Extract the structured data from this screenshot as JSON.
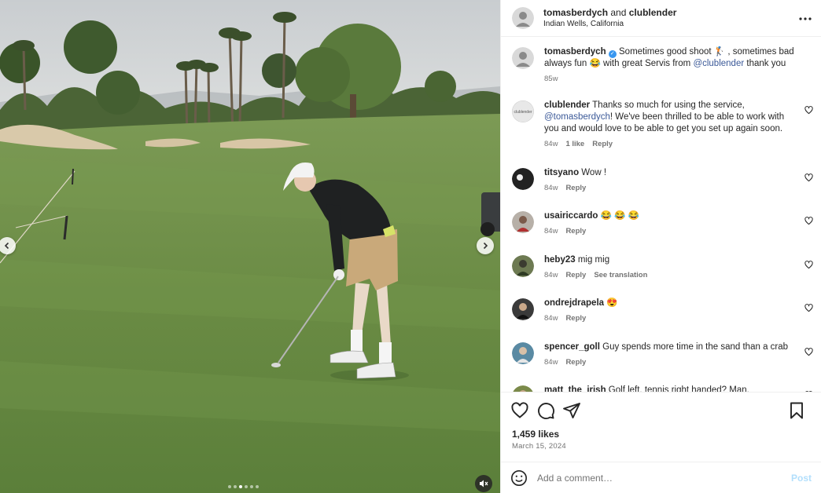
{
  "header": {
    "author1": "tomasberdych",
    "and": "and",
    "author2": "clublender",
    "location": "Indian Wells, California",
    "more_icon": "more-horizontal-icon"
  },
  "media": {
    "dots": 6,
    "active_dot": 3,
    "prev_icon": "chevron-left-icon",
    "next_icon": "chevron-right-icon",
    "mute_icon": "speaker-muted-icon"
  },
  "caption": {
    "username": "tomasberdych",
    "part1": " Sometimes good shoot 🏌️ , sometimes bad always fun 😂 with great Servis from ",
    "mention": "@clublender",
    "part2": " thank you",
    "time": "85w"
  },
  "comments": [
    {
      "username": "clublender",
      "pre": " Thanks so much for using the service, ",
      "mention": "@tomasberdych",
      "post": "! We've been thrilled to be able to work with you and would love to be able to get you set up again soon.",
      "time": "84w",
      "likes": "1 like",
      "reply": "Reply",
      "extra": ""
    },
    {
      "username": "titsyano",
      "pre": " Wow !",
      "mention": "",
      "post": "",
      "time": "84w",
      "likes": "",
      "reply": "Reply",
      "extra": ""
    },
    {
      "username": "usairiccardo",
      "pre": " 😂 😂 😂",
      "mention": "",
      "post": "",
      "time": "84w",
      "likes": "",
      "reply": "Reply",
      "extra": ""
    },
    {
      "username": "heby23",
      "pre": " mig mig",
      "mention": "",
      "post": "",
      "time": "84w",
      "likes": "",
      "reply": "Reply",
      "extra": "See translation"
    },
    {
      "username": "ondrejdrapela",
      "pre": " 😍",
      "mention": "",
      "post": "",
      "time": "84w",
      "likes": "",
      "reply": "Reply",
      "extra": ""
    },
    {
      "username": "spencer_goll",
      "pre": " Guy spends more time in the sand than a crab",
      "mention": "",
      "post": "",
      "time": "84w",
      "likes": "",
      "reply": "Reply",
      "extra": ""
    },
    {
      "username": "matt_the_irish",
      "pre": " Golf left, tennis right handed? Man.",
      "mention": "",
      "post": "",
      "time": "",
      "likes": "",
      "reply": "",
      "extra": ""
    }
  ],
  "footer": {
    "likes": "1,459 likes",
    "date": "March 15, 2024",
    "comment_placeholder": "Add a comment…",
    "post_label": "Post"
  }
}
